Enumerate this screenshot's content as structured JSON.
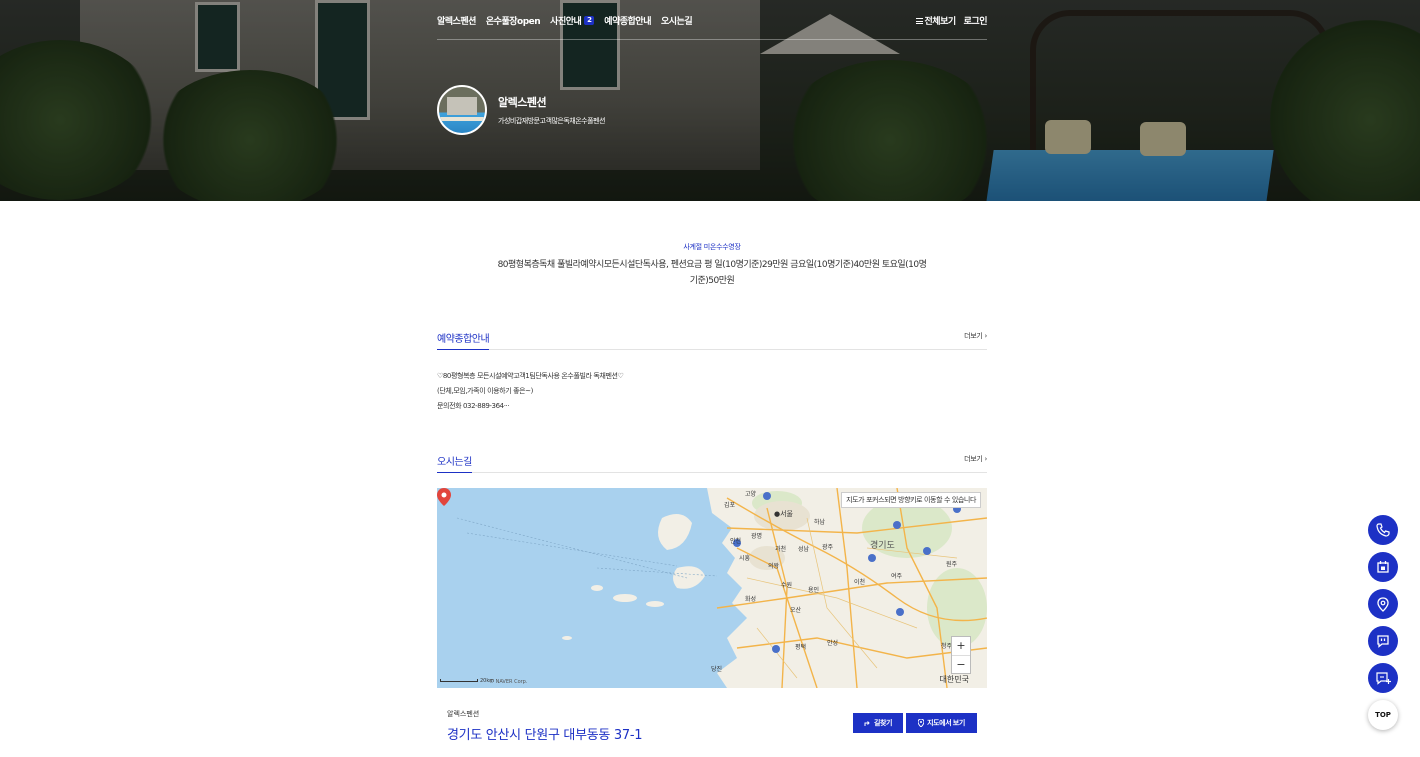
{
  "nav": {
    "items": [
      {
        "label": "알렉스펜션"
      },
      {
        "label": "온수풀장open"
      },
      {
        "label": "사진안내",
        "badge": "2"
      },
      {
        "label": "예약종합안내"
      },
      {
        "label": "오시는길"
      }
    ],
    "all_menu": "전체보기",
    "login": "로그인"
  },
  "profile": {
    "name": "알렉스펜션",
    "description": "가성비갑재방문고객많은독채온수풀펜션"
  },
  "intro": {
    "label": "사계절 미온수수영장",
    "text": "80평형복층독채 풀빌라예약시모든시설단독사용, 펜션요금 평 일(10명기준)29만원 금요일(10명기준)40만원 토요일(10명기준)50만원"
  },
  "reservation": {
    "title": "예약종합안내",
    "more": "더보기",
    "lines": [
      "♡80평형복층 모든시설예약고객1팀단독사용 온수풀빌라 독채펜션♡",
      "(단체,모임,가족이 이용하기 좋은~)",
      "문의전화 032-889-364···"
    ]
  },
  "directions": {
    "title": "오시는길",
    "more": "더보기"
  },
  "map": {
    "tip": "지도가 포커스되면 방향키로 이동할 수 있습니다",
    "zoom_in": "+",
    "zoom_out": "−",
    "scale": "20km",
    "copyright": "© NAVER Corp.",
    "country": "대한민국",
    "places": {
      "gimpo": "김포",
      "goyang": "고양",
      "seoul": "●서울",
      "hanam": "하남",
      "incheon": "인천",
      "gwangmyeong": "광명",
      "gwacheon": "과천",
      "seongnam": "성남",
      "gwangju": "광주",
      "gyeonggido": "경기도",
      "siheung": "시흥",
      "uiwang": "의왕",
      "suwon": "수원",
      "yongin": "용인",
      "icheon": "이천",
      "yeoju": "여주",
      "wonju": "원주",
      "hwaseong": "화성",
      "osan": "오산",
      "anseong": "안성",
      "pyeongtaek": "평택",
      "dangjin": "당진",
      "cheongju": "청주"
    }
  },
  "address": {
    "label": "알렉스펜션",
    "value": "경기도 안산시 단원구 대부동동 37-1",
    "route_button": "길찾기",
    "map_button": "지도에서 보기"
  },
  "floating": {
    "top": "TOP"
  },
  "colors": {
    "accent": "#1d31c5",
    "map_sea": "#a9d1ee",
    "map_land": "#f2efe6",
    "pin": "#e2453c"
  }
}
